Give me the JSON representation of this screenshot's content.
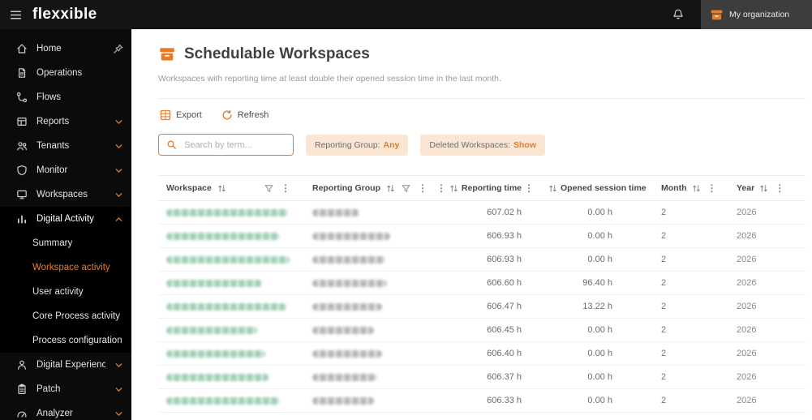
{
  "topbar": {
    "logo": "flexxible",
    "my_organization": "My organization"
  },
  "sidebar": {
    "items": [
      {
        "label": "Home",
        "icon": "home",
        "pin": true
      },
      {
        "label": "Operations",
        "icon": "operations"
      },
      {
        "label": "Flows",
        "icon": "flows"
      },
      {
        "label": "Reports",
        "icon": "reports",
        "chevron": true
      },
      {
        "label": "Tenants",
        "icon": "tenants",
        "chevron": true
      },
      {
        "label": "Monitor",
        "icon": "monitor",
        "chevron": true
      },
      {
        "label": "Workspaces",
        "icon": "workspaces",
        "chevron": true
      },
      {
        "label": "Digital Activity",
        "icon": "digital-activity",
        "chevron": true,
        "expanded": true,
        "children": [
          "Summary",
          "Workspace activity",
          "User activity",
          "Core Process activity",
          "Process configuration"
        ],
        "active_child": "Workspace activity"
      },
      {
        "label": "Digital Experience",
        "icon": "digital-experience",
        "chevron": true
      },
      {
        "label": "Patch",
        "icon": "patch",
        "chevron": true
      },
      {
        "label": "Analyzer",
        "icon": "analyzer",
        "chevron": true
      }
    ]
  },
  "main": {
    "title": "Schedulable Workspaces",
    "subtitle": "Workspaces with reporting time at least double their opened session time in the last month.",
    "toolbar": {
      "export_label": "Export",
      "refresh_label": "Refresh"
    },
    "search_placeholder": "Search by term...",
    "filters": [
      {
        "label": "Reporting Group:",
        "value": "Any"
      },
      {
        "label": "Deleted Workspaces:",
        "value": "Show"
      }
    ],
    "table": {
      "columns": [
        "Workspace",
        "Reporting Group",
        "Reporting time",
        "Opened session time",
        "Month",
        "Year"
      ],
      "rows": [
        {
          "workspace_redacted": true,
          "reporting_group_redacted": true,
          "reporting_time": "607.02 h",
          "opened_session_time": "0.00 h",
          "month": "2",
          "year": "2026"
        },
        {
          "workspace_redacted": true,
          "reporting_group_redacted": true,
          "reporting_time": "606.93 h",
          "opened_session_time": "0.00 h",
          "month": "2",
          "year": "2026"
        },
        {
          "workspace_redacted": true,
          "reporting_group_redacted": true,
          "reporting_time": "606.93 h",
          "opened_session_time": "0.00 h",
          "month": "2",
          "year": "2026"
        },
        {
          "workspace_redacted": true,
          "reporting_group_redacted": true,
          "reporting_time": "606.60 h",
          "opened_session_time": "96.40 h",
          "month": "2",
          "year": "2026"
        },
        {
          "workspace_redacted": true,
          "reporting_group_redacted": true,
          "reporting_time": "606.47 h",
          "opened_session_time": "13.22 h",
          "month": "2",
          "year": "2026"
        },
        {
          "workspace_redacted": true,
          "reporting_group_redacted": true,
          "reporting_time": "606.45 h",
          "opened_session_time": "0.00 h",
          "month": "2",
          "year": "2026"
        },
        {
          "workspace_redacted": true,
          "reporting_group_redacted": true,
          "reporting_time": "606.40 h",
          "opened_session_time": "0.00 h",
          "month": "2",
          "year": "2026"
        },
        {
          "workspace_redacted": true,
          "reporting_group_redacted": true,
          "reporting_time": "606.37 h",
          "opened_session_time": "0.00 h",
          "month": "2",
          "year": "2026"
        },
        {
          "workspace_redacted": true,
          "reporting_group_redacted": true,
          "reporting_time": "606.33 h",
          "opened_session_time": "0.00 h",
          "month": "2",
          "year": "2026"
        }
      ]
    }
  },
  "colors": {
    "accent": "#e87c26"
  }
}
